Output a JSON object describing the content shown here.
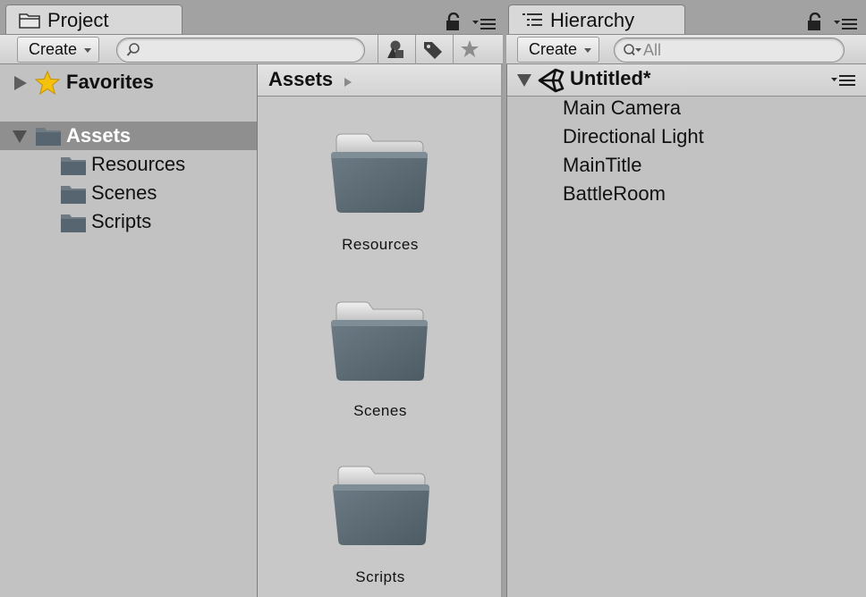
{
  "project": {
    "tab_label": "Project",
    "create_label": "Create",
    "search_placeholder": "",
    "tree": {
      "favorites_label": "Favorites",
      "assets_label": "Assets",
      "children": [
        "Resources",
        "Scenes",
        "Scripts"
      ]
    },
    "grid": {
      "breadcrumb": "Assets",
      "items": [
        "Resources",
        "Scenes",
        "Scripts"
      ]
    }
  },
  "hierarchy": {
    "tab_label": "Hierarchy",
    "create_label": "Create",
    "search_placeholder": "All",
    "scene_title": "Untitled*",
    "items": [
      "Main Camera",
      "Directional Light",
      "MainTitle",
      "BattleRoom"
    ]
  },
  "icons": {
    "project_tab": "folder-icon",
    "hierarchy_tab": "list-icon",
    "lock": "lock-icon",
    "menu": "panel-menu-icon",
    "search": "search-icon",
    "filter_type": "shapes-icon",
    "filter_label": "tag-icon",
    "favorite": "star-icon",
    "unity": "unity-logo-icon"
  },
  "colors": {
    "folder": "#5e6e78",
    "selection": "#8f8f8f",
    "star": "#f4c20d"
  }
}
